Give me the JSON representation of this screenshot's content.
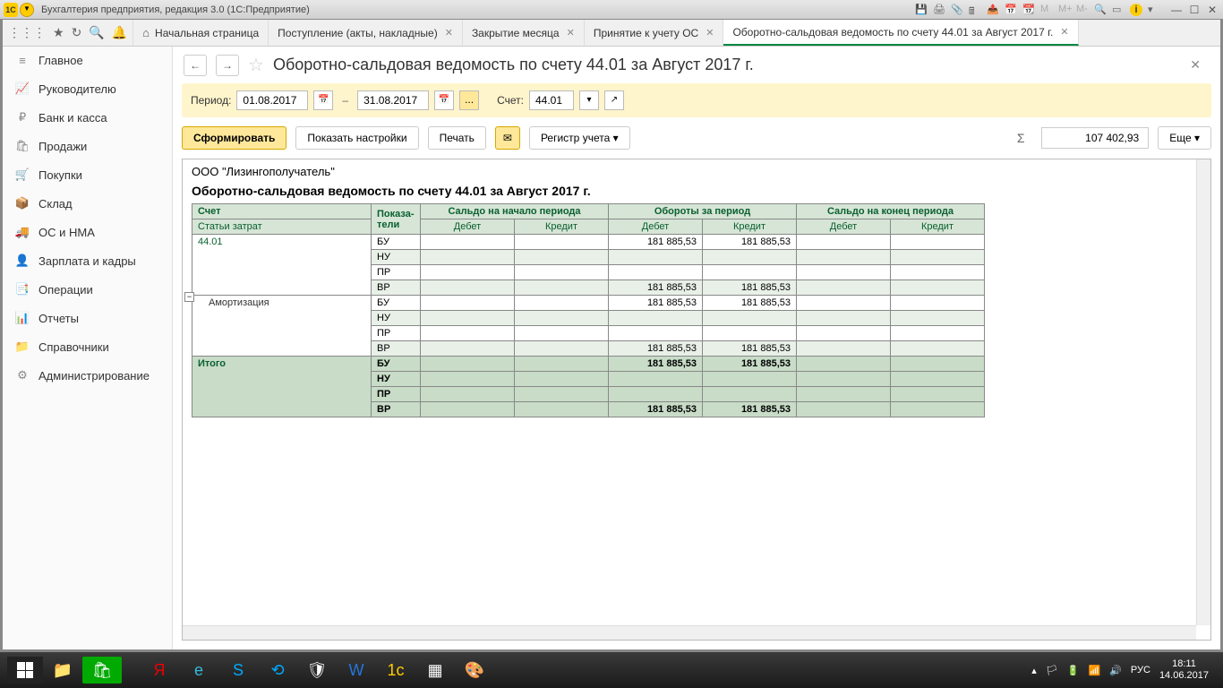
{
  "titlebar": {
    "app_title": "Бухгалтерия предприятия, редакция 3.0  (1С:Предприятие)",
    "logo_text": "1C"
  },
  "tabs": [
    {
      "label": "Начальная страница",
      "closable": false,
      "home": true
    },
    {
      "label": "Поступление (акты, накладные)",
      "closable": true
    },
    {
      "label": "Закрытие месяца",
      "closable": true
    },
    {
      "label": "Принятие к учету ОС",
      "closable": true
    },
    {
      "label": "Оборотно-сальдовая ведомость по счету 44.01 за Август 2017 г.",
      "closable": true,
      "active": true
    }
  ],
  "sidebar": [
    {
      "icon": "≡",
      "label": "Главное"
    },
    {
      "icon": "📈",
      "label": "Руководителю"
    },
    {
      "icon": "₽",
      "label": "Банк и касса"
    },
    {
      "icon": "🛍",
      "label": "Продажи"
    },
    {
      "icon": "🛒",
      "label": "Покупки"
    },
    {
      "icon": "📦",
      "label": "Склад"
    },
    {
      "icon": "🚚",
      "label": "ОС и НМА"
    },
    {
      "icon": "👤",
      "label": "Зарплата и кадры"
    },
    {
      "icon": "📑",
      "label": "Операции"
    },
    {
      "icon": "📊",
      "label": "Отчеты"
    },
    {
      "icon": "📁",
      "label": "Справочники"
    },
    {
      "icon": "⚙",
      "label": "Администрирование"
    }
  ],
  "page": {
    "title": "Оборотно-сальдовая ведомость по счету 44.01 за Август 2017 г."
  },
  "period": {
    "label": "Период:",
    "from": "01.08.2017",
    "to": "31.08.2017",
    "account_label": "Счет:",
    "account": "44.01"
  },
  "actions": {
    "generate": "Сформировать",
    "show_settings": "Показать настройки",
    "print": "Печать",
    "register": "Регистр учета",
    "more": "Еще",
    "sum_value": "107 402,93"
  },
  "report": {
    "org": "ООО \"Лизингополучатель\"",
    "title": "Оборотно-сальдовая ведомость по счету 44.01 за Август 2017 г.",
    "headers": {
      "account": "Счет",
      "indicators": "Показа-\nтели",
      "articles": "Статьи затрат",
      "begin": "Сальдо на начало периода",
      "turnover": "Обороты за период",
      "end": "Сальдо на конец периода",
      "debit": "Дебет",
      "credit": "Кредит",
      "total": "Итого"
    },
    "indicator_labels": [
      "БУ",
      "НУ",
      "ПР",
      "ВР"
    ],
    "rows": [
      {
        "name": "44.01",
        "values": [
          {
            "ind": "БУ",
            "bd": "",
            "bc": "",
            "td": "181 885,53",
            "tc": "181 885,53",
            "ed": "",
            "ec": ""
          },
          {
            "ind": "НУ",
            "bd": "",
            "bc": "",
            "td": "",
            "tc": "",
            "ed": "",
            "ec": ""
          },
          {
            "ind": "ПР",
            "bd": "",
            "bc": "",
            "td": "",
            "tc": "",
            "ed": "",
            "ec": ""
          },
          {
            "ind": "ВР",
            "bd": "",
            "bc": "",
            "td": "181 885,53",
            "tc": "181 885,53",
            "ed": "",
            "ec": ""
          }
        ]
      },
      {
        "name": "Амортизация",
        "sub": true,
        "values": [
          {
            "ind": "БУ",
            "bd": "",
            "bc": "",
            "td": "181 885,53",
            "tc": "181 885,53",
            "ed": "",
            "ec": ""
          },
          {
            "ind": "НУ",
            "bd": "",
            "bc": "",
            "td": "",
            "tc": "",
            "ed": "",
            "ec": ""
          },
          {
            "ind": "ПР",
            "bd": "",
            "bc": "",
            "td": "",
            "tc": "",
            "ed": "",
            "ec": ""
          },
          {
            "ind": "ВР",
            "bd": "",
            "bc": "",
            "td": "181 885,53",
            "tc": "181 885,53",
            "ed": "",
            "ec": ""
          }
        ]
      }
    ],
    "total_row": {
      "values": [
        {
          "ind": "БУ",
          "bd": "",
          "bc": "",
          "td": "181 885,53",
          "tc": "181 885,53",
          "ed": "",
          "ec": ""
        },
        {
          "ind": "НУ",
          "bd": "",
          "bc": "",
          "td": "",
          "tc": "",
          "ed": "",
          "ec": ""
        },
        {
          "ind": "ПР",
          "bd": "",
          "bc": "",
          "td": "",
          "tc": "",
          "ed": "",
          "ec": ""
        },
        {
          "ind": "ВР",
          "bd": "",
          "bc": "",
          "td": "181 885,53",
          "tc": "181 885,53",
          "ed": "",
          "ec": ""
        }
      ]
    }
  },
  "taskbar": {
    "lang": "РУС",
    "time": "18:11",
    "date": "14.06.2017"
  }
}
